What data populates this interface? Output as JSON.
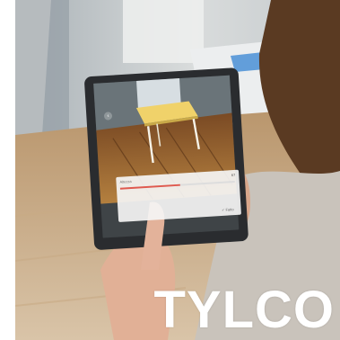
{
  "brand": {
    "wordmark": "TYLCO"
  },
  "app_ui": {
    "slider_label": "Altezza",
    "slider_value": "67",
    "confirm_label": "✓ Fatto",
    "slider_level": 0.52
  },
  "icons": {
    "back": "back-arrow-icon"
  },
  "colors": {
    "accent": "#e05a4f",
    "table_top": "#f0d26a",
    "floor": "#9a6a3e"
  }
}
